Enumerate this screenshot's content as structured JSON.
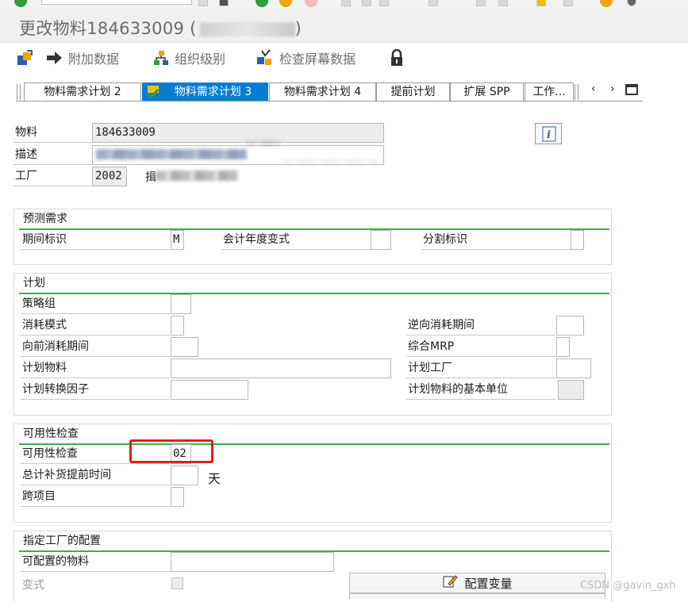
{
  "title": {
    "prefix": "更改物料184633009 (",
    "suffix": ")"
  },
  "toolbar": {
    "additional_data": "附加数据",
    "org_levels": "组织级别",
    "check_screen_data": "检查屏幕数据"
  },
  "tabs": [
    {
      "label": "物料需求计划 2",
      "active": false
    },
    {
      "label": "物料需求计划 3",
      "active": true
    },
    {
      "label": "物料需求计划 4",
      "active": false
    },
    {
      "label": "提前计划",
      "active": false
    },
    {
      "label": "扩展 SPP",
      "active": false
    },
    {
      "label": "工作...",
      "active": false
    }
  ],
  "header": {
    "material_label": "物料",
    "material_value": "184633009",
    "description_label": "描述",
    "plant_label": "工厂",
    "plant_value": "2002",
    "plant_desc_first_char": "揖"
  },
  "sections": {
    "forecast": {
      "title": "预测需求",
      "period_indicator_label": "期间标识",
      "period_indicator_value": "M",
      "fiscal_year_variant_label": "会计年度变式",
      "fiscal_year_variant_value": "",
      "splitting_indicator_label": "分割标识",
      "splitting_indicator_value": ""
    },
    "planning": {
      "title": "计划",
      "strategy_group_label": "策略组",
      "consumption_mode_label": "消耗模式",
      "backward_consumption_label": "逆向消耗期间",
      "forward_consumption_label": "向前消耗期间",
      "mixed_mrp_label": "综合MRP",
      "planning_material_label": "计划物料",
      "planning_plant_label": "计划工厂",
      "conversion_factor_label": "计划转换因子",
      "base_unit_label": "计划物料的基本单位"
    },
    "availability": {
      "title": "可用性检查",
      "availability_check_label": "可用性检查",
      "availability_check_value": "02",
      "total_repl_lead_time_label": "总计补货提前时间",
      "days_unit": "天",
      "cross_project_label": "跨项目"
    },
    "plant_config": {
      "title": "指定工厂的配置",
      "configurable_material_label": "可配置的物料",
      "variant_label": "变式",
      "config_variant_button": "配置变量"
    }
  },
  "watermark": "CSDN @gavin_gxh",
  "colors": {
    "active_tab": "#0a7ccf",
    "section_line": "#3cb043",
    "highlight_box": "#e02020"
  }
}
